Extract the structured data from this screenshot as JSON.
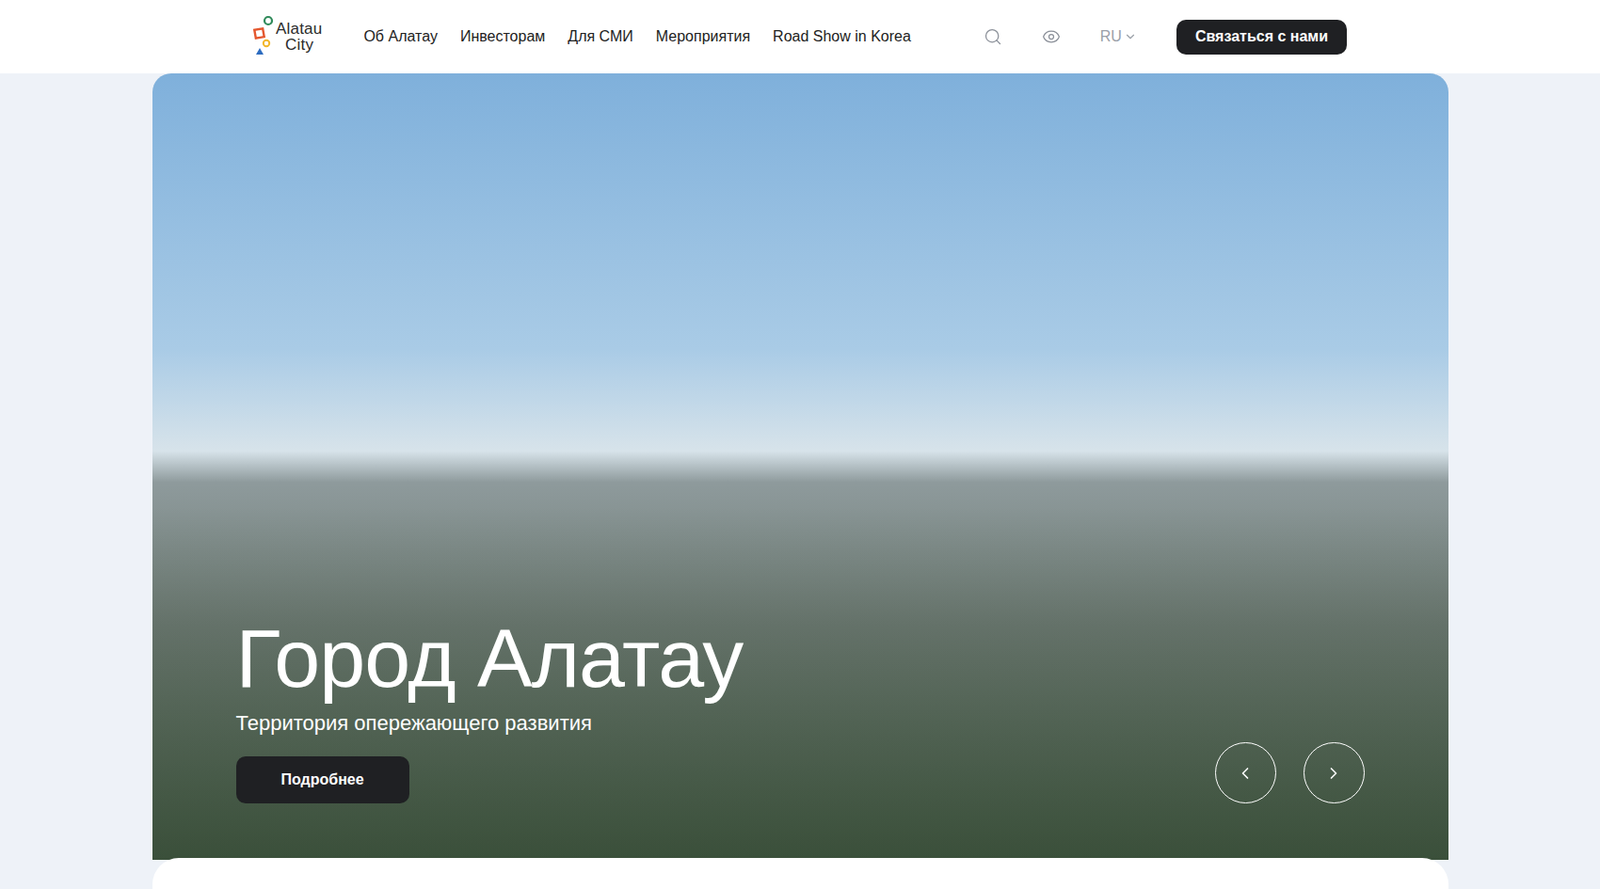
{
  "header": {
    "logo": {
      "line1": "Alatau",
      "line2": "City"
    },
    "nav": [
      {
        "label": "Об Алатау"
      },
      {
        "label": "Инвесторам"
      },
      {
        "label": "Для СМИ"
      },
      {
        "label": "Мероприятия"
      },
      {
        "label": "Road Show in Korea"
      }
    ],
    "language": "RU",
    "contact_button": "Связаться с нами"
  },
  "hero": {
    "title": "Город Алатау",
    "subtitle": "Территория опережающего развития",
    "button": "Подробнее"
  }
}
